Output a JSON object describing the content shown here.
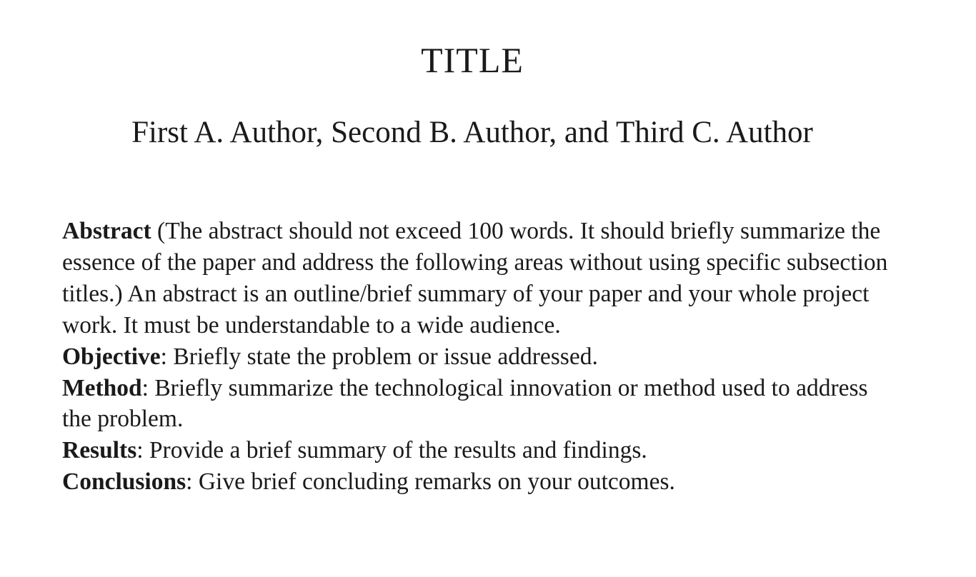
{
  "paper": {
    "title": "TITLE",
    "authors": "First A. Author, Second B. Author, and Third C. Author",
    "abstract": {
      "label": "Abstract",
      "text": " (The abstract should not exceed 100 words. It should briefly summarize the essence of the paper and address the following areas without using specific subsection titles.) An abstract is an outline/brief summary of your paper and your whole project work. It must be understandable to a wide audience."
    },
    "objective": {
      "label": "Objective",
      "text": ": Briefly state the problem or issue addressed."
    },
    "method": {
      "label": "Method",
      "text": ": Briefly summarize the technological innovation or method used to address the problem."
    },
    "results": {
      "label": "Results",
      "text": ": Provide a brief summary of the results and findings."
    },
    "conclusions": {
      "label": "Conclusions",
      "text": ": Give brief concluding remarks on your outcomes."
    }
  }
}
